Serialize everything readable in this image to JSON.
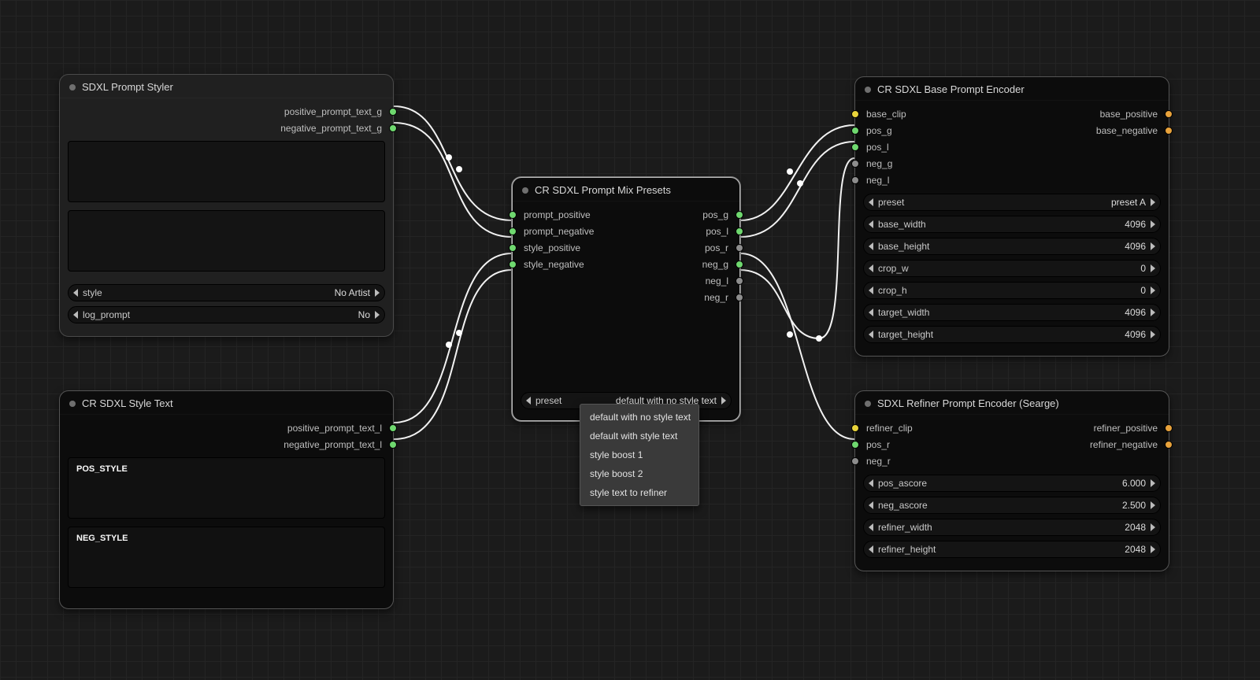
{
  "nodes": {
    "styler": {
      "title": "SDXL Prompt Styler",
      "out": {
        "p": "positive_prompt_text_g",
        "n": "negative_prompt_text_g"
      },
      "style": {
        "label": "style",
        "value": "No Artist"
      },
      "log": {
        "label": "log_prompt",
        "value": "No"
      }
    },
    "styleText": {
      "title": "CR SDXL Style Text",
      "out": {
        "p": "positive_prompt_text_l",
        "n": "negative_prompt_text_l"
      },
      "pos_box": "POS_STYLE",
      "neg_box": "NEG_STYLE"
    },
    "mix": {
      "title": "CR SDXL Prompt Mix Presets",
      "in": {
        "pp": "prompt_positive",
        "pn": "prompt_negative",
        "sp": "style_positive",
        "sn": "style_negative"
      },
      "out": {
        "pg": "pos_g",
        "pl": "pos_l",
        "pr": "pos_r",
        "ng": "neg_g",
        "nl": "neg_l",
        "nr": "neg_r"
      },
      "preset": {
        "label": "preset",
        "value": "default with no style text"
      },
      "menu": [
        "default with no style text",
        "default with style text",
        "style boost 1",
        "style boost 2",
        "style text to refiner"
      ]
    },
    "base": {
      "title": "CR SDXL Base Prompt Encoder",
      "in": {
        "clip": "base_clip",
        "pg": "pos_g",
        "pl": "pos_l",
        "ng": "neg_g",
        "nl": "neg_l"
      },
      "out": {
        "bp": "base_positive",
        "bn": "base_negative"
      },
      "rows": [
        {
          "label": "preset",
          "value": "preset A"
        },
        {
          "label": "base_width",
          "value": "4096"
        },
        {
          "label": "base_height",
          "value": "4096"
        },
        {
          "label": "crop_w",
          "value": "0"
        },
        {
          "label": "crop_h",
          "value": "0"
        },
        {
          "label": "target_width",
          "value": "4096"
        },
        {
          "label": "target_height",
          "value": "4096"
        }
      ]
    },
    "refiner": {
      "title": "SDXL Refiner Prompt Encoder (Searge)",
      "in": {
        "clip": "refiner_clip",
        "pr": "pos_r",
        "nr": "neg_r"
      },
      "out": {
        "rp": "refiner_positive",
        "rn": "refiner_negative"
      },
      "rows": [
        {
          "label": "pos_ascore",
          "value": "6.000"
        },
        {
          "label": "neg_ascore",
          "value": "2.500"
        },
        {
          "label": "refiner_width",
          "value": "2048"
        },
        {
          "label": "refiner_height",
          "value": "2048"
        }
      ]
    }
  }
}
